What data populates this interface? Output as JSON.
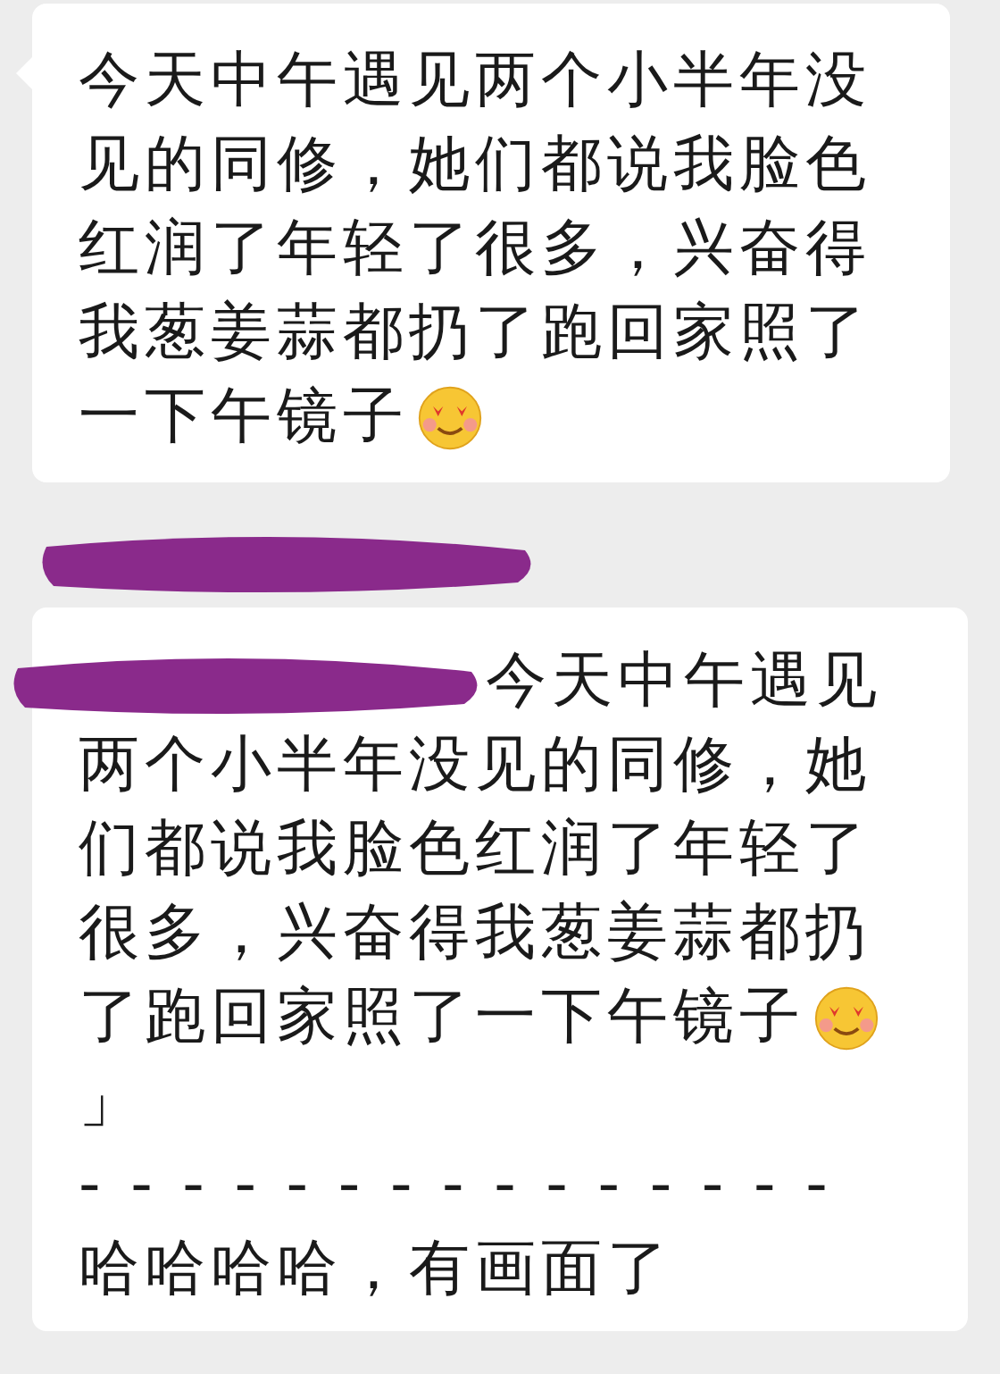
{
  "message": {
    "lines": [
      {
        "text": "今天中午遇见两个小半年没",
        "emoji": false
      },
      {
        "text": "见的同修，她们都说我脸色",
        "emoji": false
      },
      {
        "text": "红润了年轻了很多，兴奋得",
        "emoji": false
      },
      {
        "text": "我葱姜蒜都扔了跑回家照了",
        "emoji": false
      },
      {
        "text": "一下午镜子",
        "emoji": true
      }
    ]
  },
  "reply": {
    "lines": [
      {
        "text": "今天中午遇见",
        "emoji": false,
        "redacted": true
      },
      {
        "text": "两个小半年没见的同修，她",
        "emoji": false,
        "redacted": false
      },
      {
        "text": "们都说我脸色红润了年轻了",
        "emoji": false,
        "redacted": false
      },
      {
        "text": "很多，兴奋得我葱姜蒜都扔",
        "emoji": false,
        "redacted": false
      },
      {
        "text": "了跑回家照了一下午镜子",
        "emoji": true,
        "redacted": false
      },
      {
        "text": "」",
        "emoji": false,
        "redacted": false
      },
      {
        "text": "- - - - - - - - - - - - - - -",
        "emoji": false,
        "redacted": false
      },
      {
        "text": "哈哈哈哈，有画面了",
        "emoji": false,
        "redacted": false
      }
    ]
  }
}
